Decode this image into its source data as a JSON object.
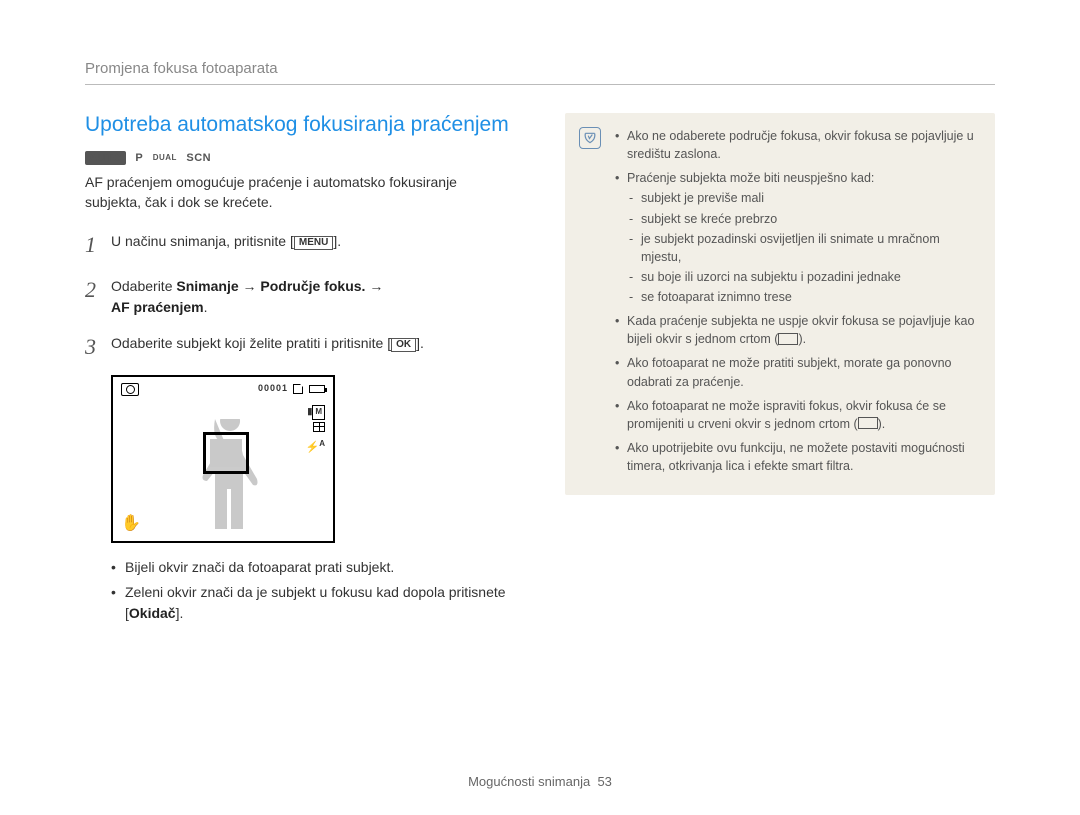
{
  "header": {
    "title": "Promjena fokusa fotoaparata"
  },
  "section": {
    "title": "Upotreba automatskog fokusiranja praćenjem"
  },
  "modes": {
    "auto": "AUTO",
    "p": "P",
    "dual": "DUAL",
    "scn": "SCN"
  },
  "intro": "AF praćenjem omogućuje praćenje i automatsko fokusiranje subjekta, čak i dok se krećete.",
  "steps": {
    "s1_pre": "U načinu snimanja, pritisnite [",
    "s1_btn": "MENU",
    "s1_post": "].",
    "s2": "Odaberite ",
    "s2_b1": "Snimanje",
    "s2_arrow": " → ",
    "s2_b2": "Područje fokus.",
    "s2_b3": "AF praćenjem",
    "s2_post": ".",
    "s3_pre": "Odaberite subjekt koji želite pratiti i pritisnite [",
    "s3_btn": "OK",
    "s3_post": "]."
  },
  "screen": {
    "counter": "00001",
    "m": "M",
    "flash": "A"
  },
  "sub_bullets": [
    "Bijeli okvir znači da fotoaparat prati subjekt.",
    "Zeleni okvir znači da je subjekt u fokusu kad dopola pritisnete"
  ],
  "okidac": "Okidač",
  "notes": {
    "n1": "Ako ne odaberete područje fokusa, okvir fokusa se pojavljuje u središtu zaslona.",
    "n2_head": "Praćenje subjekta može biti neuspješno kad:",
    "n2_items": [
      "subjekt je previše mali",
      "subjekt se kreće prebrzo",
      "je subjekt pozadinski osvijetljen ili snimate u mračnom mjestu,",
      "su boje ili uzorci na subjektu i pozadini jednake",
      "se fotoaparat iznimno trese"
    ],
    "n3_a": "Kada praćenje subjekta ne uspje okvir fokusa se pojavljuje kao bijeli okvir s jednom crtom (",
    "n3_b": ").",
    "n4": "Ako fotoaparat ne može pratiti subjekt, morate ga ponovno odabrati za praćenje.",
    "n5_a": "Ako fotoaparat ne može ispraviti fokus, okvir fokusa će se promijeniti u crveni okvir s jednom crtom (",
    "n5_b": ").",
    "n6": "Ako upotrijebite ovu funkciju, ne možete postaviti mogućnosti timera, otkrivanja lica i efekte smart filtra."
  },
  "footer": {
    "section": "Mogućnosti snimanja",
    "page": "53"
  }
}
